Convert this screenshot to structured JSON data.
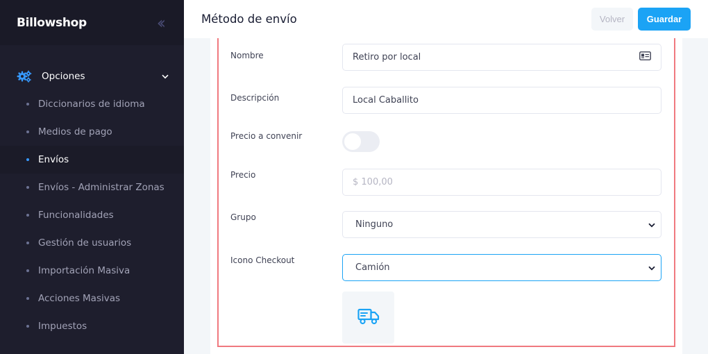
{
  "sidebar": {
    "brand": "Billowshop",
    "collapse_icon": "double-chevron-left-icon",
    "section": {
      "label": "Opciones",
      "icon": "gears-icon",
      "chevron": "chevron-down-icon"
    },
    "items": [
      {
        "label": "Diccionarios de idioma",
        "active": false
      },
      {
        "label": "Medios de pago",
        "active": false
      },
      {
        "label": "Envíos",
        "active": true
      },
      {
        "label": "Envíos - Administrar Zonas",
        "active": false
      },
      {
        "label": "Funcionalidades",
        "active": false
      },
      {
        "label": "Gestión de usuarios",
        "active": false
      },
      {
        "label": "Importación Masiva",
        "active": false
      },
      {
        "label": "Acciones Masivas",
        "active": false
      },
      {
        "label": "Impuestos",
        "active": false
      }
    ]
  },
  "header": {
    "title": "Método de envío",
    "back_label": "Volver",
    "save_label": "Guardar"
  },
  "form": {
    "nombre": {
      "label": "Nombre",
      "value": "Retiro por local",
      "icon": "id-card-icon"
    },
    "descripcion": {
      "label": "Descripción",
      "value": "Local Caballito"
    },
    "precio_convenir": {
      "label": "Precio a convenir",
      "checked": false
    },
    "precio": {
      "label": "Precio",
      "placeholder": "$ 100,00"
    },
    "grupo": {
      "label": "Grupo",
      "selected": "Ninguno"
    },
    "icono": {
      "label": "Icono Checkout",
      "selected": "Camión",
      "preview_icon": "truck-icon"
    }
  },
  "colors": {
    "accent": "#1ba3f5",
    "sidebar_bg": "#1e1e2d",
    "highlight_border": "#f0797f"
  }
}
